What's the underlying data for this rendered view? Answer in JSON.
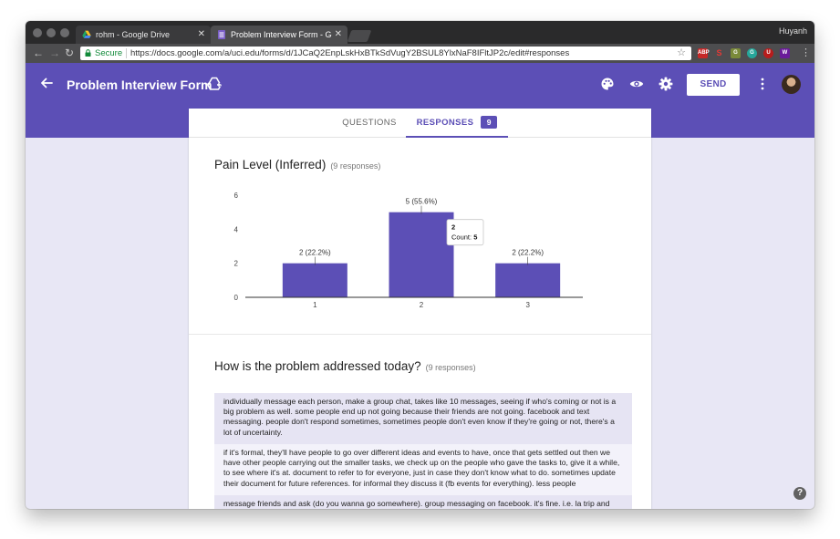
{
  "browser": {
    "profile_name": "Huyanh",
    "tabs": [
      {
        "title": "rohm - Google Drive",
        "active": false,
        "icon": "google-drive-icon"
      },
      {
        "title": "Problem Interview Form - Goo",
        "active": true,
        "icon": "google-forms-icon"
      }
    ],
    "address": {
      "secure_label": "Secure",
      "url": "https://docs.google.com/a/uci.edu/forms/d/1JCaQ2EnpLskHxBTkSdVugY2BSUL8YlxNaF8IFltJP2c/edit#responses"
    },
    "extensions": [
      "ABP",
      "S",
      "G",
      "G",
      "U",
      "W"
    ]
  },
  "app": {
    "title": "Problem Interview Form",
    "send_label": "SEND",
    "accent": "#5c4fb6",
    "background": "#e8e7f5",
    "icons": [
      "back-arrow-icon",
      "add-to-drive-icon",
      "palette-icon",
      "preview-eye-icon",
      "settings-gear-icon",
      "more-vert-icon",
      "avatar"
    ]
  },
  "form_tabs": {
    "questions": "QUESTIONS",
    "responses": "RESPONSES",
    "response_count": "9"
  },
  "question1": {
    "title": "Pain Level (Inferred)",
    "count": "(9 responses)"
  },
  "chart_data": {
    "type": "bar",
    "categories": [
      "1",
      "2",
      "3"
    ],
    "values": [
      2,
      5,
      2
    ],
    "data_labels": [
      "2 (22.2%)",
      "5 (55.6%)",
      "2 (22.2%)"
    ],
    "y_ticks": [
      "0",
      "2",
      "4",
      "6"
    ],
    "ylim": [
      0,
      6
    ],
    "color": "#5c4fb6",
    "grid": false,
    "tooltip": {
      "category": "2",
      "label": "Count:",
      "value": "5"
    }
  },
  "question2": {
    "title": "How is the problem addressed today?",
    "count": "(9 responses)",
    "responses": [
      "individually message each person, make a group chat, takes like 10 messages, seeing if who's coming or not is a big problem as well. some people end up not going because their friends are not going. facebook and text messaging. people don't respond sometimes, sometimes people don't even know if they're going or not, there's a lot of uncertainty.",
      "if it's formal, they'll have people to go over different ideas and events to have, once that gets settled out then we have other people carrying out the smaller tasks, we check up on the people who gave the tasks to, give it a while, to see where it's at. document to refer to for everyone, just in case they don't know what to do. sometimes update their document for future references. for informal they discuss it (fb events for everything). less people",
      "message friends and ask (do you wanna go somewhere). group messaging on facebook. it's fine. i.e. la trip and"
    ]
  },
  "help_label": "?"
}
